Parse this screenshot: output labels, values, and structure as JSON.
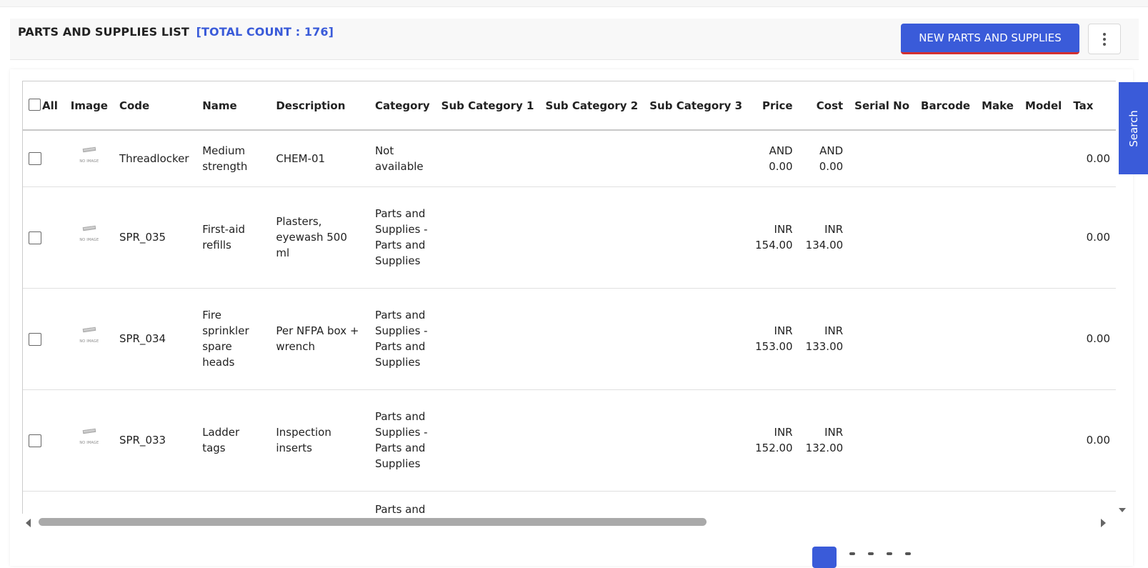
{
  "header": {
    "title": "PARTS AND SUPPLIES LIST",
    "count_label": "[TOTAL COUNT : 176]",
    "new_button": "NEW PARTS AND SUPPLIES"
  },
  "search_tab": "Search",
  "table": {
    "all_label": "All",
    "columns": [
      "Image",
      "Code",
      "Name",
      "Description",
      "Category",
      "Sub Category 1",
      "Sub Category 2",
      "Sub Category 3",
      "Price",
      "Cost",
      "Serial No",
      "Barcode",
      "Make",
      "Model",
      "Tax"
    ],
    "no_image_text": "NO IMAGE",
    "rows": [
      {
        "code": "Threadlocker",
        "name": "Medium strength",
        "description": "CHEM-01",
        "category": "Not available",
        "sub1": "",
        "sub2": "",
        "sub3": "",
        "price": "AND 0.00",
        "cost": "AND 0.00",
        "serial": "",
        "barcode": "",
        "make": "",
        "model": "",
        "tax": "0.00"
      },
      {
        "code": "SPR_035",
        "name": "First-aid refills",
        "description": "Plasters, eyewash 500 ml",
        "category": "Parts and Supplies - Parts and Supplies",
        "sub1": "",
        "sub2": "",
        "sub3": "",
        "price": "INR 154.00",
        "cost": "INR 134.00",
        "serial": "",
        "barcode": "",
        "make": "",
        "model": "",
        "tax": "0.00"
      },
      {
        "code": "SPR_034",
        "name": "Fire sprinkler spare heads",
        "description": "Per NFPA box + wrench",
        "category": "Parts and Supplies - Parts and Supplies",
        "sub1": "",
        "sub2": "",
        "sub3": "",
        "price": "INR 153.00",
        "cost": "INR 133.00",
        "serial": "",
        "barcode": "",
        "make": "",
        "model": "",
        "tax": "0.00"
      },
      {
        "code": "SPR_033",
        "name": "Ladder tags",
        "description": "Inspection inserts",
        "category": "Parts and Supplies - Parts and Supplies",
        "sub1": "",
        "sub2": "",
        "sub3": "",
        "price": "INR 152.00",
        "cost": "INR 132.00",
        "serial": "",
        "barcode": "",
        "make": "",
        "model": "",
        "tax": "0.00"
      },
      {
        "code": "",
        "name": "",
        "description": "",
        "category": "Parts and Supplies - Parts and Supplies",
        "sub1": "",
        "sub2": "",
        "sub3": "",
        "price": "",
        "cost": "",
        "serial": "",
        "barcode": "",
        "make": "",
        "model": "",
        "tax": ""
      }
    ]
  }
}
